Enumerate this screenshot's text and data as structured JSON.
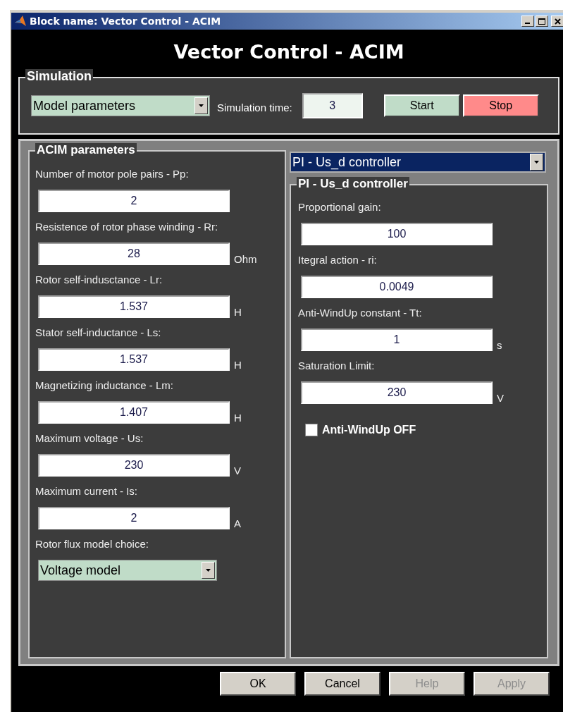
{
  "window": {
    "title": "Block name: Vector Control - ACIM"
  },
  "heading": "Vector Control - ACIM",
  "simulation": {
    "legend": "Simulation",
    "mode": "Model parameters",
    "time_label": "Simulation time:",
    "time_value": "3",
    "start": "Start",
    "stop": "Stop"
  },
  "acim": {
    "legend": "ACIM parameters",
    "fields": [
      {
        "label": "Number of motor pole pairs - Pp:",
        "value": "2"
      },
      {
        "label": "Resistence of rotor phase winding - Rr:",
        "value": "28",
        "unit": "Ohm"
      },
      {
        "label": "Rotor self-indusctance - Lr:",
        "value": "1.537",
        "unit": "H"
      },
      {
        "label": "Stator self-inductance - Ls:",
        "value": "1.537",
        "unit": "H"
      },
      {
        "label": "Magnetizing inductance - Lm:",
        "value": "1.407",
        "unit": "H"
      },
      {
        "label": "Maximum voltage - Us:",
        "value": "230",
        "unit": "V"
      },
      {
        "label": "Maximum current - Is:",
        "value": "2",
        "unit": "A"
      }
    ],
    "flux_label": "Rotor flux model choice:",
    "flux_model": "Voltage model"
  },
  "controller": {
    "selector": "PI - Us_d controller",
    "legend": "PI - Us_d controller",
    "fields": [
      {
        "label": "Proportional gain:",
        "value": "100"
      },
      {
        "label": "Itegral action - ri:",
        "value": "0.0049"
      },
      {
        "label": "Anti-WindUp constant - Tt:",
        "value": "1",
        "unit": "s"
      },
      {
        "label": "Saturation Limit:",
        "value": "230",
        "unit": "V"
      }
    ],
    "antiwindup": {
      "label": "Anti-WindUp OFF",
      "checked": false
    }
  },
  "buttons": [
    {
      "label": "OK",
      "disabled": false
    },
    {
      "label": "Cancel",
      "disabled": false
    },
    {
      "label": "Help",
      "disabled": true
    },
    {
      "label": "Apply",
      "disabled": true
    }
  ]
}
